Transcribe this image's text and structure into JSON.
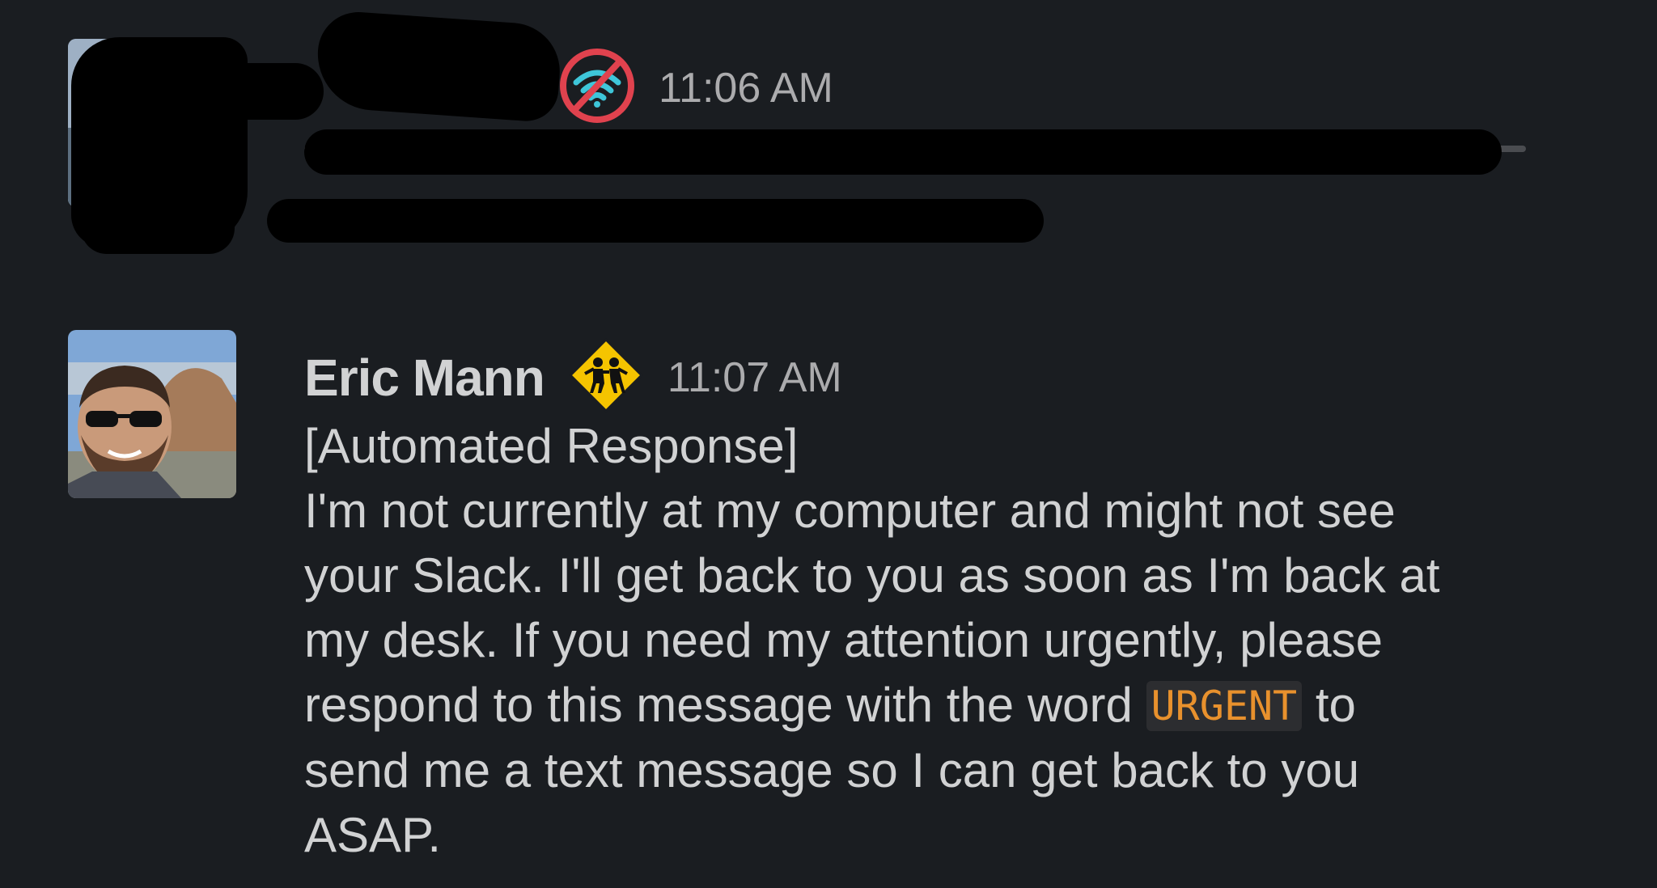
{
  "messages": [
    {
      "sender": "",
      "timestamp": "11:06 AM",
      "status_icon": "no-wifi-icon",
      "text": "",
      "redacted": true
    },
    {
      "sender": "Eric Mann",
      "timestamp": "11:07 AM",
      "status_icon": "children-crossing-icon",
      "text_lines": [
        "[Automated Response]",
        "I'm not currently at my computer and might not see",
        "your Slack.  I'll get back to you as soon as I'm back at",
        "my desk. If you need my attention urgently, please"
      ],
      "line5_before": "respond to this message with the word ",
      "code_word": "URGENT",
      "line5_after": " to",
      "text_lines_end": [
        "send me a text message so I can get back to you",
        "ASAP."
      ]
    }
  ],
  "colors": {
    "background": "#1a1d21",
    "text": "#d1d2d3",
    "timestamp": "#ababad",
    "code_text": "#e8912d",
    "code_background": "#2c2d30",
    "no_wifi_red": "#e0424e",
    "no_wifi_teal": "#3ec6d9",
    "warning_yellow": "#f5c400"
  }
}
